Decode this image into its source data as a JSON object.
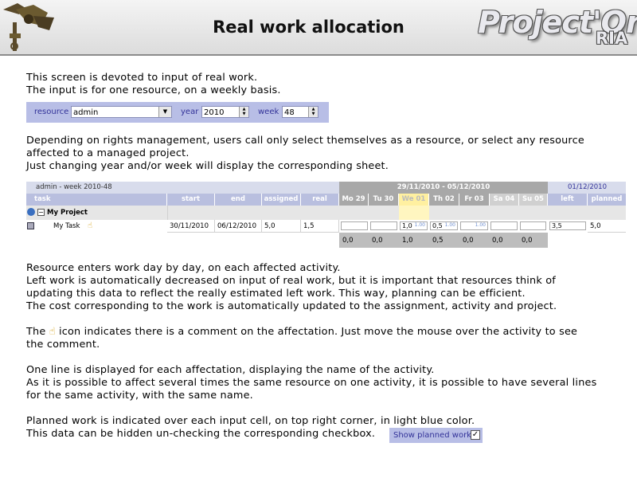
{
  "header": {
    "title": "Real work allocation",
    "brand": "Project'Or",
    "brand_sub": "RIA"
  },
  "intro": {
    "line1": "This screen is devoted to input of real work.",
    "line2": "The input is for one resource, on a weekly basis."
  },
  "selector": {
    "resource_label": "resource",
    "resource_value": "admin",
    "year_label": "year",
    "year_value": "2010",
    "week_label": "week",
    "week_value": "48"
  },
  "para2": {
    "line1": "Depending on rights management, users call only select themselves as a resource, or select any resource",
    "line2": "affected to a managed project.",
    "line3": "Just changing year and/or week will display the corresponding sheet."
  },
  "grid": {
    "caption": "admin - week 2010-48",
    "range": "29/11/2010 - 05/12/2010",
    "today": "01/12/2010",
    "columns": [
      "task",
      "start",
      "end",
      "assigned",
      "real",
      "Mo 29",
      "Tu 30",
      "We 01",
      "Th 02",
      "Fr 03",
      "Sa 04",
      "Su 05",
      "left",
      "planned"
    ],
    "project_name": "My Project",
    "task_row": {
      "name": "My Task",
      "start": "30/11/2010",
      "end": "06/12/2010",
      "assigned": "5,0",
      "real": "1,5",
      "we": "1,0",
      "we_plan": "1.00",
      "th": "0,5",
      "th_plan": "1.00",
      "fr_plan": "1.00",
      "left": "3,5",
      "planned": "5,0"
    },
    "totals": [
      "0,0",
      "0,0",
      "1,0",
      "0,5",
      "0,0",
      "0,0",
      "0,0"
    ]
  },
  "para3": {
    "line1": "Resource enters work day by day, on each affected activity.",
    "line2": "Left work is automatically decreased on input of real work, but it is important that resources think of",
    "line3": "updating this data to reflect the really estimated left work. This way, planning can be efficient.",
    "line4": "The cost corresponding to the work is automatically updated to the assignment, activity and project."
  },
  "para4": {
    "before": "The",
    "after": "icon indicates there is a comment on the affectation. Just move the mouse over the activity to see",
    "line2": "the comment."
  },
  "para5": {
    "line1": "One line is displayed for each affectation, displaying the name of the activity.",
    "line2": "As it is possible to affect several times the same resource on one activity, it is possible to have several lines",
    "line3": "for the same activity, with the same name."
  },
  "para6": {
    "line1": "Planned work is indicated over each input cell, on top right corner, in light blue color.",
    "line2": "This data can be hidden un-checking the corresponding checkbox."
  },
  "checkbox": {
    "label": "Show planned work",
    "mark": "✓"
  }
}
